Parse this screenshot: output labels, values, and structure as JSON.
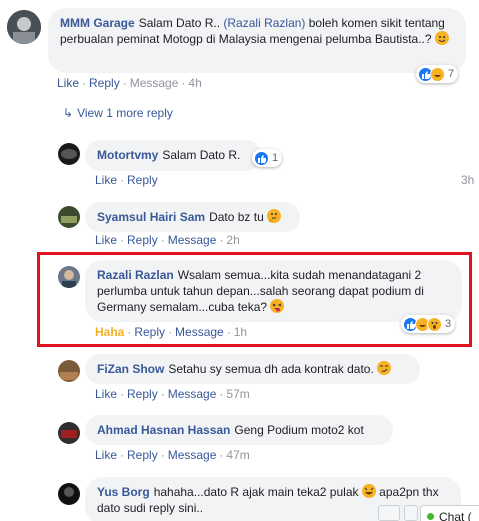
{
  "comments": [
    {
      "author": "MMM Garage",
      "text_before": "Salam Dato R.. ",
      "mention": "(Razali Razlan)",
      "text_after": " boleh komen sikit tentang perbualan peminat Motogp di Malaysia mengenai pelumba Bautista..?",
      "actions": {
        "like": "Like",
        "reply": "Reply",
        "message": "Message",
        "time": "4h"
      },
      "reaction_count": "7"
    },
    {
      "author": "Motortvmy",
      "text": "Salam Dato R.",
      "actions": {
        "like": "Like",
        "reply": "Reply",
        "time": "3h"
      },
      "reaction_count": "1"
    },
    {
      "author": "Syamsul Hairi Sam",
      "text": "Dato bz tu",
      "actions": {
        "like": "Like",
        "reply": "Reply",
        "message": "Message",
        "time": "2h"
      }
    },
    {
      "author": "Razali Razlan",
      "text": "Wsalam semua...kita sudah menandatagani 2 perlumba untuk tahun depan...salah seorang dapat podium di Germany semalam...cuba teka?",
      "actions": {
        "like": "Haha",
        "reply": "Reply",
        "message": "Message",
        "time": "1h"
      },
      "reaction_count": "3"
    },
    {
      "author": "FiZan Show",
      "text": "Setahu sy semua dh ada kontrak dato.",
      "actions": {
        "like": "Like",
        "reply": "Reply",
        "message": "Message",
        "time": "57m"
      }
    },
    {
      "author": "Ahmad Hasnan Hassan",
      "text": "Geng Podium moto2 kot",
      "actions": {
        "like": "Like",
        "reply": "Reply",
        "message": "Message",
        "time": "47m"
      }
    },
    {
      "author": "Yus Borg",
      "text": "hahaha...dato R ajak main teka2 pulak",
      "text_after": " apa2pn thx dato sudi reply sini.."
    }
  ],
  "view_more": "View 1 more reply",
  "chat": {
    "label": "Chat ("
  },
  "colors": {
    "link": "#385898",
    "bubble": "#f2f3f5",
    "highlight": "#e0141e",
    "haha": "#f7b125"
  }
}
